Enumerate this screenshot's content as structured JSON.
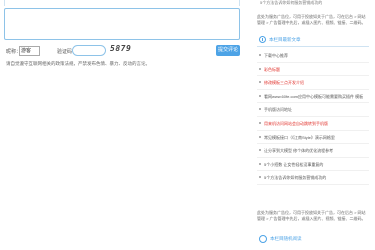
{
  "comment_form": {
    "name_label": "昵称：",
    "name_value": "游客",
    "code_label": "验证码：",
    "captcha": "5879",
    "submit": "提交评论",
    "hint": "请自觉遵守互联网相关的政策法规，严禁发布色情、暴力、反动的言论。"
  },
  "sidebar": {
    "top_item": "5个方法告诉你如何服务营销成功的",
    "ad_text_1": "此处为服务广告位，可用于投放如关于广告，可在后台 > 网站管理 > 广告管理中先后，或插入图片、视频、链接、二维码。",
    "section1_title": "本栏目最新文章",
    "items": [
      {
        "label": "下载中心推荐",
        "red": false
      },
      {
        "label": "彩色标题",
        "red": true
      },
      {
        "label": "修改模板三点开发介绍",
        "red": true
      },
      {
        "label": "看网www.60fe.com应用中心模板可能需要购买插件 模板",
        "red": false
      },
      {
        "label": "手机版访问地址",
        "red": false
      },
      {
        "label": "用来机访问网站会自动跳转到手机版",
        "red": true
      },
      {
        "label": "常见模板接口（《江南Style》演示网格里",
        "red": false
      },
      {
        "label": "让分享到大模型 修个体的优化流程参考",
        "red": false
      },
      {
        "label": "5个小招数 让女性轻松没事重复的",
        "red": false
      },
      {
        "label": "5个方法告诉你如何服务营销成功的",
        "red": false
      }
    ],
    "ad_text_2": "此处为服务广告位，可用于投放如关于广告，可在后台 > 网站管理 > 广告管理中先后，或插入图片、视频、链接、二维码。",
    "section2_title": "本栏目随机阅读"
  }
}
